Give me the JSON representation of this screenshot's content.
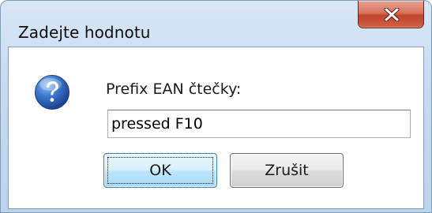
{
  "window": {
    "title": "Zadejte hodnotu"
  },
  "titlebar": {
    "close_icon": "close-x-icon"
  },
  "dialog": {
    "icon": "question-icon",
    "prompt": "Prefix EAN čtečky:",
    "input_value": "pressed F10",
    "ok_label": "OK",
    "cancel_label": "Zrušit"
  },
  "colors": {
    "close_button": "#c7472e",
    "question_icon": "#2f6bc4",
    "default_button_border": "#3c7fb1"
  }
}
